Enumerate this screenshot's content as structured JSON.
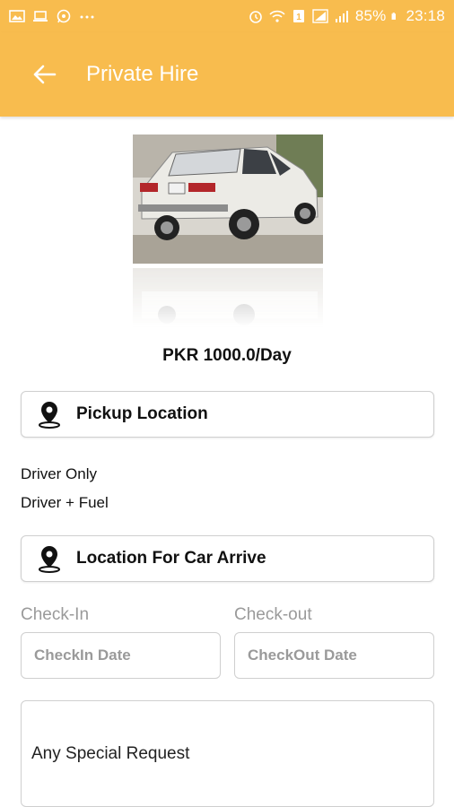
{
  "status_bar": {
    "battery": "85%",
    "time": "23:18",
    "left_icons": [
      "gallery-icon",
      "laptop-icon",
      "whatsapp-icon",
      "more-dots-icon"
    ],
    "right_icons": [
      "alarm-icon",
      "wifi-icon",
      "sim-icon",
      "signal-icon",
      "battery-icon"
    ]
  },
  "app_bar": {
    "title": "Private Hire",
    "back_icon": "arrow-left-icon",
    "color": "#f8bc4e"
  },
  "car": {
    "price": "PKR 1000.0/Day"
  },
  "pickup": {
    "label": "Pickup Location",
    "icon": "location-pin-icon"
  },
  "options": {
    "driver_only": "Driver Only",
    "driver_fuel": "Driver + Fuel"
  },
  "arrive": {
    "label": "Location For Car Arrive",
    "icon": "location-pin-icon"
  },
  "dates": {
    "checkin_label": "Check-In",
    "checkout_label": "Check-out",
    "checkin_placeholder": "CheckIn Date",
    "checkout_placeholder": "CheckOut Date"
  },
  "request": {
    "placeholder": "Any Special Request"
  }
}
